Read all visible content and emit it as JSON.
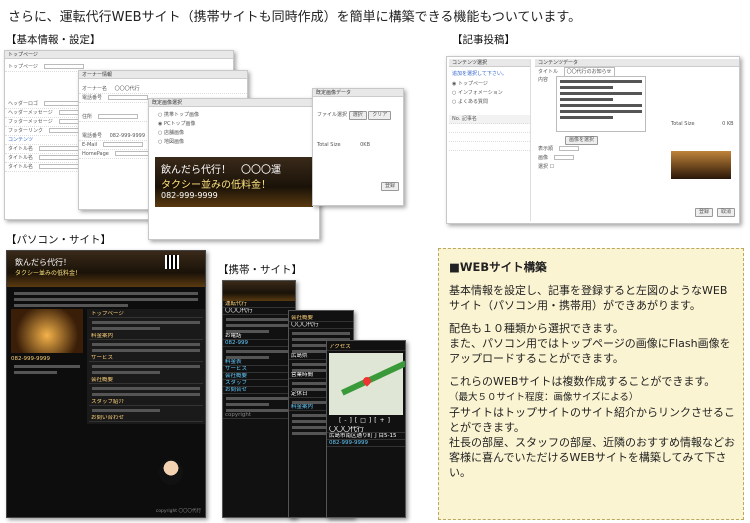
{
  "headline": "さらに、運転代行WEBサイト（携帯サイトも同時作成）を簡単に構築できる機能もついています。",
  "sections": {
    "basic_info": "【基本情報・設定】",
    "article_post": "【記事投稿】",
    "pc_site": "【パソコン・サイト】",
    "mobile_site": "【携帯・サイト】"
  },
  "basic_screens": {
    "s1_title": "トップページ",
    "s1_rows": [
      "トップページ",
      "ヘッダーロゴ",
      "ヘッダーメッセージ",
      "フッターメッセージ",
      "フッターリンク",
      "コンテンツ",
      "タイトル名",
      "タイトル名",
      "タイトル名"
    ],
    "s2_title": "オーナー情報",
    "s2_rows": [
      "オーナー名",
      "電話番号",
      "住所",
      "電話番号",
      "E-Mail",
      "HomePage"
    ],
    "s2_owner_value": "〇〇〇代行",
    "s2_phone_value": "082-999-9999",
    "s3_title": "既定画像選択",
    "s3_options": [
      "携帯トップ画像",
      "PCトップ画像",
      "店舗画像",
      "地図画像"
    ],
    "s3_banner_line1": "飲んだら代行！　〇〇〇運",
    "s3_banner_line2": "タクシー並みの低料金！",
    "s3_banner_phone": "082-999-9999",
    "s4_title": "既定画像データ",
    "s4_file_label": "ファイル選択",
    "s4_btn1": "選択",
    "s4_btn2": "クリア",
    "s4_total": "Total Size",
    "s4_total_value": "0KB",
    "s4_save": "登録"
  },
  "article_screens": {
    "list_title": "コンテンツ選択",
    "list_hint": "追加を選択して下さい。",
    "list_options": [
      "トップページ",
      "インフォメーション",
      "よくある質問"
    ],
    "list_col": "No. 記事名",
    "edit_title": "コンテンツデータ",
    "edit_rows": [
      "タイトル",
      "内容",
      "表示順",
      "画像",
      "選択"
    ],
    "edit_title_value": "〇〇代行のお知らせ",
    "edit_btn": "画像を選択",
    "edit_total": "Total Size",
    "edit_total_value": "0 KB",
    "edit_save": "登録",
    "edit_cancel": "取消"
  },
  "pc_mock": {
    "banner": "飲んだら代行！",
    "sub": "タクシー並みの低料金！",
    "nav": [
      "トップページ",
      "料金案内",
      "サービス",
      "会社概要",
      "スタッフ紹介",
      "お問い合わせ"
    ],
    "phone": "082-999-9999",
    "footer": "copyright 〇〇〇代行"
  },
  "mobile_mock": {
    "p1_lines": [
      "運転代行",
      "〇〇〇代行",
      "お電話",
      "082-999",
      "料金表",
      "サービス",
      "会社概要",
      "スタッフ",
      "お問合せ",
      "copyright"
    ],
    "p2_lines": [
      "会社概要",
      "〇〇〇代行",
      "広島県",
      "営業時間",
      "定休日",
      "料金案内"
    ],
    "p3_lines": [
      "アクセス",
      "〇〇〇代行",
      "広島市南区通り町丁目5-15",
      "082-999-9999"
    ]
  },
  "note": {
    "title": "■WEBサイト構築",
    "p1": "基本情報を設定し、記事を登録すると左図のようなWEBサイト（パソコン用・携帯用）ができあがります。",
    "p2a": "配色も１０種類から選択できます。",
    "p2b": "また、パソコン用ではトップページの画像にFlash画像をアップロードすることができます。",
    "p3a": "これらのWEBサイトは複数作成することができます。",
    "p3_small": "（最大５０サイト程度：画像サイズによる）",
    "p3b": "子サイトはトップサイトのサイト紹介からリンクさせることができます。",
    "p3c": "社長の部屋、スタッフの部屋、近隣のおすすめ情報などお客様に喜んでいただけるWEBサイトを構築してみて下さい。"
  }
}
